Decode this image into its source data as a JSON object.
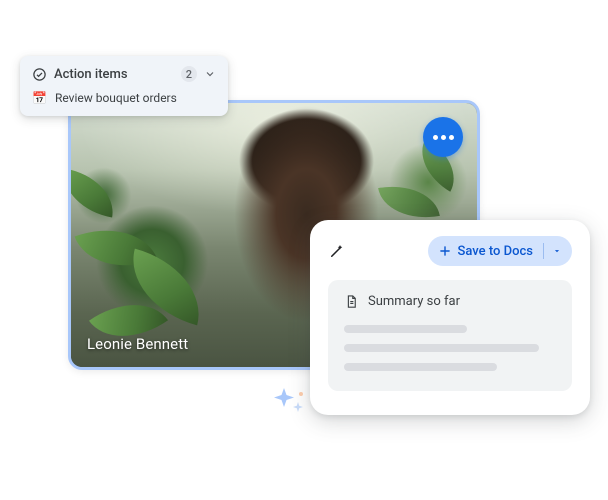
{
  "video": {
    "participant_name": "Leonie Bennett"
  },
  "action_items": {
    "title": "Action items",
    "count": "2",
    "items": [
      {
        "icon": "📅",
        "label": "Review bouquet orders"
      }
    ]
  },
  "summary": {
    "save_button_label": "Save to Docs",
    "title": "Summary so far"
  }
}
